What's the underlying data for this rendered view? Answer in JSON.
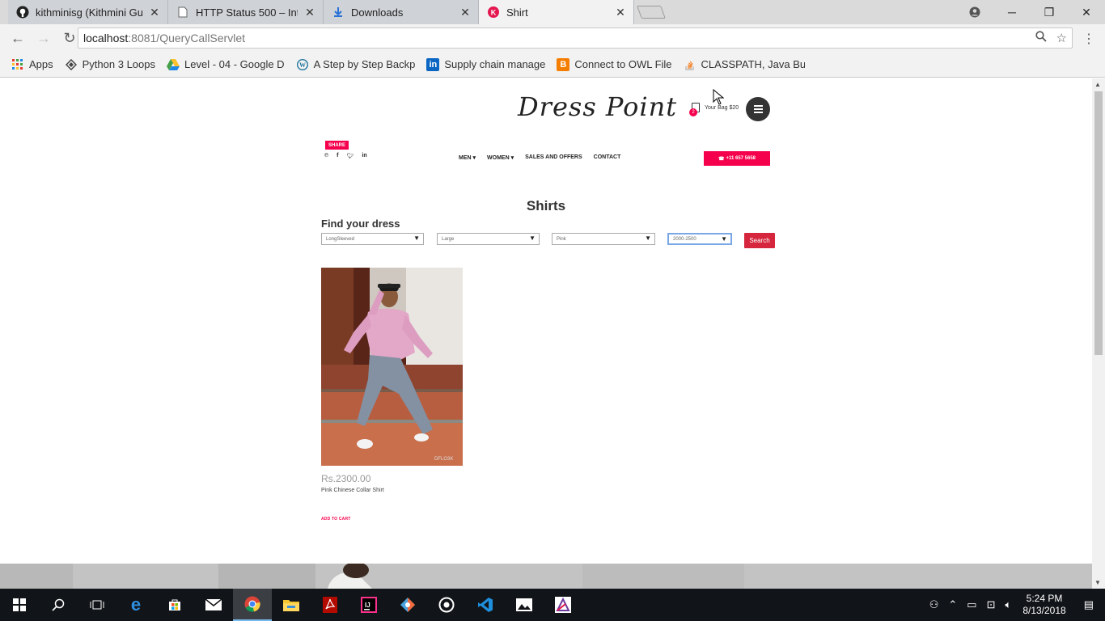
{
  "browser": {
    "tabs": [
      {
        "title": "kithminisg (Kithmini Gun…",
        "icon": "github-icon",
        "active": false
      },
      {
        "title": "HTTP Status 500 – Interna",
        "icon": "page-icon",
        "active": false
      },
      {
        "title": "Downloads",
        "icon": "download-icon",
        "active": false
      },
      {
        "title": "Shirt",
        "icon": "k-logo-icon",
        "active": true
      }
    ],
    "address": {
      "host": "localhost",
      "path": ":8081/QueryCallServlet"
    },
    "bookmarks": [
      {
        "label": "Apps",
        "icon": "apps-grid-icon"
      },
      {
        "label": "Python 3 Loops",
        "icon": "python-icon"
      },
      {
        "label": "Level - 04 - Google D",
        "icon": "google-drive-icon"
      },
      {
        "label": "A Step by Step Backp",
        "icon": "wordpress-icon"
      },
      {
        "label": "Supply chain manage",
        "icon": "linkedin-icon"
      },
      {
        "label": "Connect to OWL File",
        "icon": "blogger-icon"
      },
      {
        "label": "CLASSPATH, Java Buil",
        "icon": "stackoverflow-icon"
      }
    ]
  },
  "site": {
    "logo": "Dress Point",
    "bag_label": "Your Bag $20",
    "bag_count": "2",
    "share_label": "SHARE",
    "nav": {
      "men": "MEN",
      "women": "WOMEN",
      "sales": "SALES AND OFFERS",
      "contact": "CONTACT"
    },
    "phone": "+11 657 5658"
  },
  "page": {
    "title": "Shirts",
    "find_title": "Find your dress",
    "filters": {
      "sleeve": "LongSleeved",
      "size": "Large",
      "color": "Pink",
      "price": "2000-2500"
    },
    "search_label": "Search"
  },
  "product": {
    "price": "Rs.2300.00",
    "name": "Pink Chinese Collar Shirt",
    "add_to_cart": "ADD TO CART",
    "watermark": "DFLO3K"
  },
  "taskbar": {
    "time": "5:24 PM",
    "date": "8/13/2018"
  }
}
